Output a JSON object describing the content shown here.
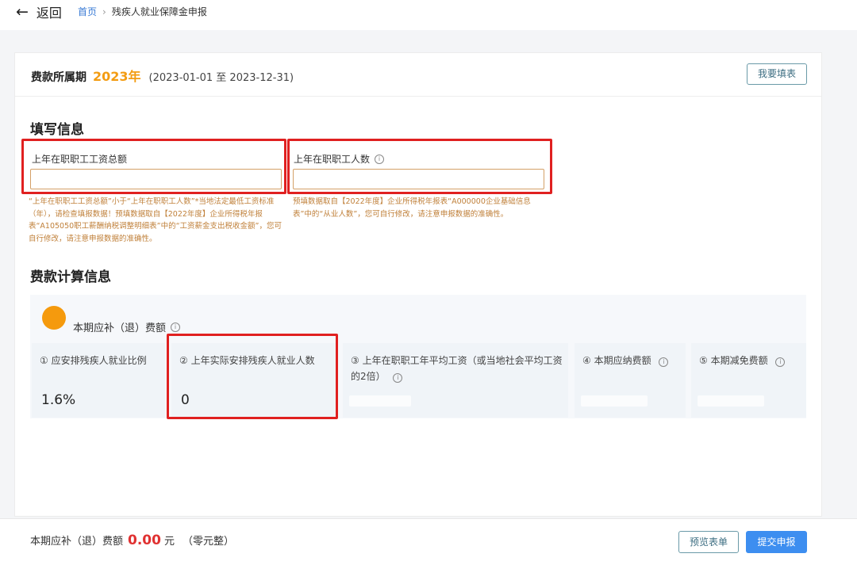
{
  "nav": {
    "back_label": "返回",
    "breadcrumb_home": "首页",
    "breadcrumb_separator": "›",
    "breadcrumb_current": "残疾人就业保障金申报"
  },
  "period": {
    "label": "费款所属期",
    "year": "2023年",
    "range": "(2023-01-01 至 2023-12-31)",
    "fill_button": "我要填表"
  },
  "fill_section": {
    "title": "填写信息",
    "field_wage": {
      "label": "上年在职职工工资总额",
      "value": "",
      "hint": "“上年在职职工工资总额”小于“上年在职职工人数”*当地法定最低工资标准（年），请检查填报数据！预填数据取自【2022年度】企业所得税年报表“A105050职工薪酬纳税调整明细表”中的“工资薪金支出税收金额”，您可自行修改，请注意申报数据的准确性。"
    },
    "field_headcount": {
      "label": "上年在职职工人数",
      "value": "",
      "hint": "预填数据取自【2022年度】企业所得税年报表“A000000企业基础信息表”中的“从业人数”，您可自行修改，请注意申报数据的准确性。"
    }
  },
  "calc_section": {
    "title": "费款计算信息",
    "summary_label": "本期应补（退）费额",
    "cards": [
      {
        "label": "① 应安排残疾人就业比例",
        "value": "1.6%"
      },
      {
        "label": "② 上年实际安排残疾人就业人数",
        "value": "0"
      },
      {
        "label": "③ 上年在职职工年平均工资（或当地社会平均工资的2倍）",
        "value": ""
      },
      {
        "label": "④ 本期应纳费额",
        "value": ""
      },
      {
        "label": "⑤ 本期减免费额",
        "value": ""
      }
    ]
  },
  "footer": {
    "summary_label": "本期应补（退）费额",
    "amount": "0.00",
    "unit": "元",
    "amount_words": "（零元整）",
    "preview_button": "预览表单",
    "submit_button": "提交申报"
  },
  "colors": {
    "accent_orange": "#f39c12",
    "highlight_red": "#e02020",
    "primary_blue": "#3d8ef0",
    "amount_red": "#e03131"
  }
}
